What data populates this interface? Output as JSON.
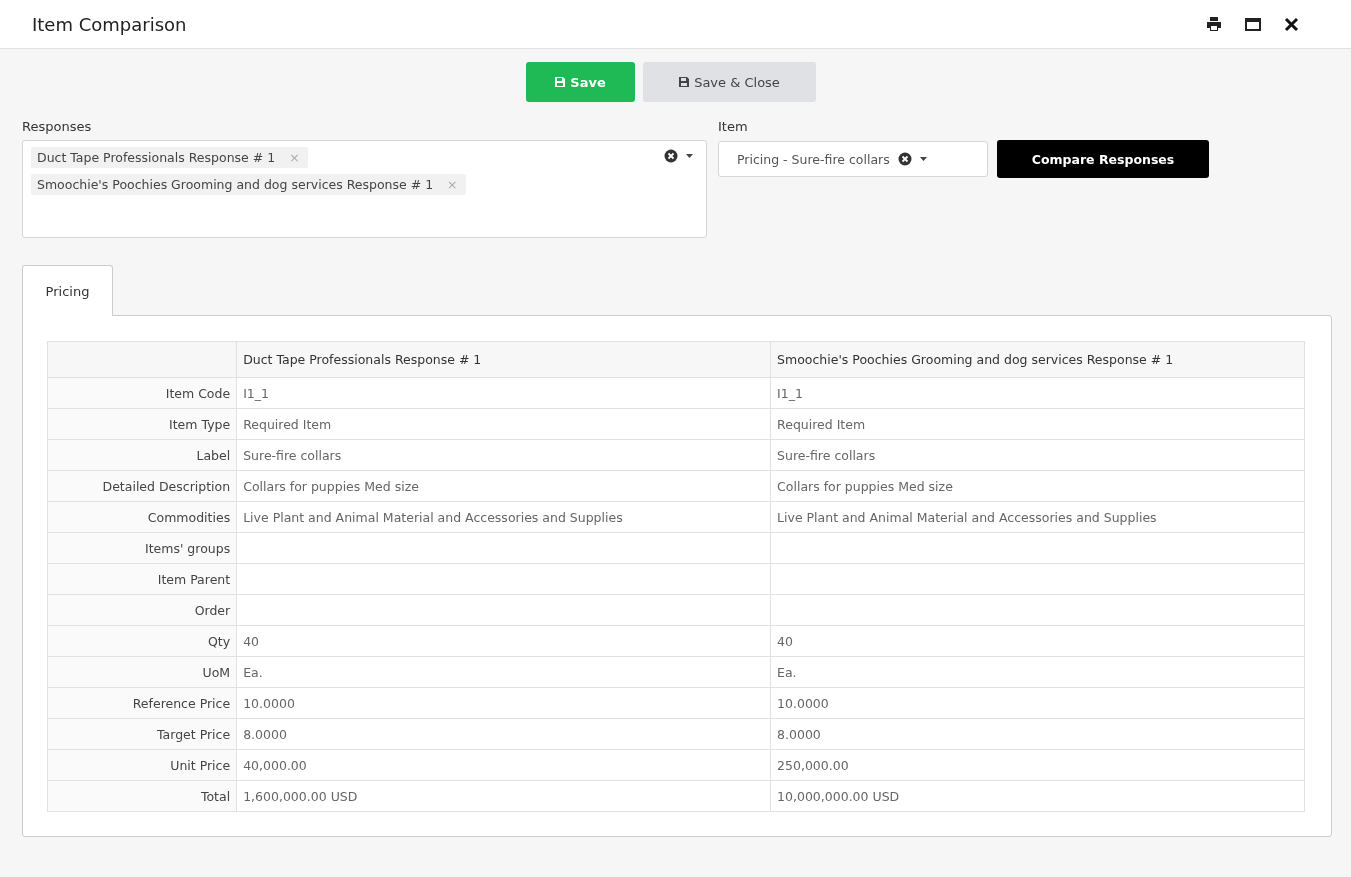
{
  "window": {
    "title": "Item Comparison"
  },
  "actions": [
    {
      "label": "Save",
      "kind": "primary"
    },
    {
      "label": "Save & Close",
      "kind": "secondary"
    }
  ],
  "responses": {
    "label": "Responses",
    "tags": [
      {
        "label": "Duct Tape Professionals Response # 1",
        "remove": "×"
      },
      {
        "label": "Smoochie's Poochies Grooming and dog services Response # 1",
        "remove": "×"
      }
    ]
  },
  "item": {
    "label": "Item",
    "value": "Pricing - Sure-fire collars"
  },
  "compare_button": "Compare Responses",
  "tabs": [
    {
      "label": "Pricing",
      "selected": true
    }
  ],
  "table": {
    "columns": [
      "Duct Tape Professionals Response # 1",
      "Smoochie's Poochies Grooming and dog services Response # 1"
    ],
    "rows": [
      {
        "label": "Item Code",
        "values": [
          "I1_1",
          "I1_1"
        ]
      },
      {
        "label": "Item Type",
        "values": [
          "Required Item",
          "Required Item"
        ]
      },
      {
        "label": "Label",
        "values": [
          "Sure-fire collars",
          "Sure-fire collars"
        ]
      },
      {
        "label": "Detailed Description",
        "values": [
          "Collars for puppies Med size",
          "Collars for puppies Med size"
        ]
      },
      {
        "label": "Commodities",
        "values": [
          "Live Plant and Animal Material and Accessories and Supplies",
          "Live Plant and Animal Material and Accessories and Supplies"
        ]
      },
      {
        "label": "Items' groups",
        "values": []
      },
      {
        "label": "Item Parent",
        "values": []
      },
      {
        "label": "Order",
        "values": []
      },
      {
        "label": "Qty",
        "values": [
          "40",
          "40"
        ]
      },
      {
        "label": "UoM",
        "values": [
          "Ea.",
          "Ea."
        ]
      },
      {
        "label": "Reference Price",
        "values": [
          "10.0000",
          "10.0000"
        ]
      },
      {
        "label": "Target Price",
        "values": [
          "8.0000",
          "8.0000"
        ]
      },
      {
        "label": "Unit Price",
        "values": [
          "40,000.00",
          "250,000.00"
        ]
      },
      {
        "label": "Total",
        "values": [
          "1,600,000.00 USD",
          "10,000,000.00 USD"
        ]
      }
    ]
  }
}
